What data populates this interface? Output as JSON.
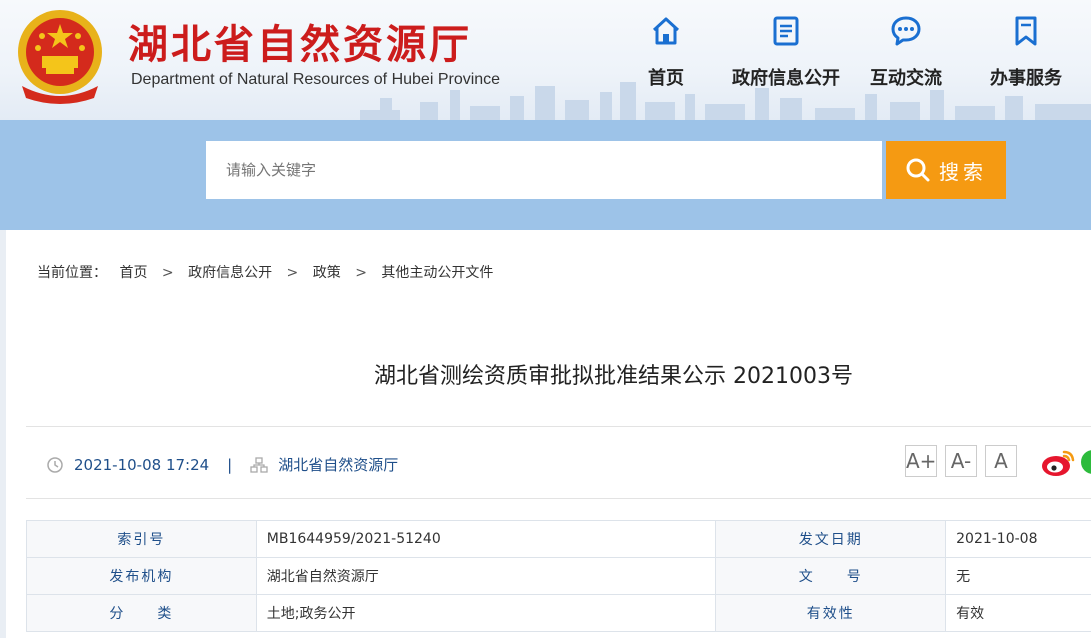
{
  "header": {
    "title": "湖北省自然资源厅",
    "subtitle": "Department of Natural Resources of Hubei Province",
    "nav": [
      {
        "label": "首页",
        "icon": "home-icon"
      },
      {
        "label": "政府信息公开",
        "icon": "document-icon"
      },
      {
        "label": "互动交流",
        "icon": "chat-icon"
      },
      {
        "label": "办事服务",
        "icon": "bookmark-icon"
      }
    ]
  },
  "search": {
    "placeholder": "请输入关键字",
    "button_label": "搜索"
  },
  "breadcrumb": {
    "prefix": "当前位置：",
    "items": [
      "首页",
      "政府信息公开",
      "政策",
      "其他主动公开文件"
    ],
    "separator": ">"
  },
  "article": {
    "title": "湖北省测绘资质审批拟批准结果公示 2021003号",
    "datetime": "2021-10-08 17:24",
    "divider": "|",
    "source": "湖北省自然资源厅",
    "font_buttons": [
      "A+",
      "A-",
      "A"
    ]
  },
  "info_table": {
    "rows": [
      {
        "l1": "索引号",
        "v1": "MB1644959/2021-51240",
        "l2": "发文日期",
        "v2": "2021-10-08"
      },
      {
        "l1": "发布机构",
        "v1": "湖北省自然资源厅",
        "l2": "文　　号",
        "v2": "无"
      },
      {
        "l1": "分　　类",
        "v1": "土地;政务公开",
        "l2": "有效性",
        "v2": "有效"
      }
    ]
  },
  "colors": {
    "brand_red": "#cc1c1c",
    "nav_blue": "#1a6fd1",
    "band_blue": "#9dc3e8",
    "search_orange": "#f59a12",
    "link_blue": "#1f4f8a"
  }
}
